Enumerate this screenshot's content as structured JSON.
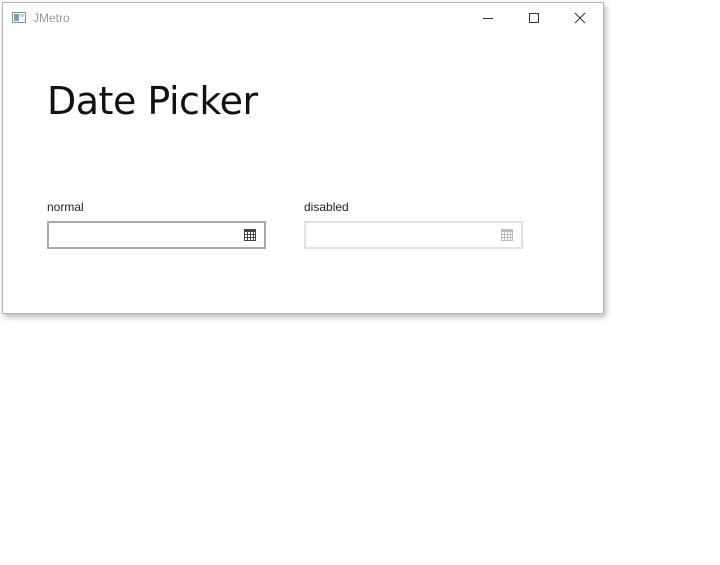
{
  "window": {
    "title": "JMetro",
    "controls": [
      "minimize-icon",
      "maximize-icon",
      "close-icon"
    ]
  },
  "main": {
    "title": "Date Picker",
    "pickers": [
      {
        "label": "normal",
        "value": "",
        "enabled": true,
        "icon": "calendar-icon"
      },
      {
        "label": "disabled",
        "value": "",
        "enabled": false,
        "icon": "calendar-icon"
      }
    ]
  },
  "colors": {
    "border_normal": "#a9a9a9",
    "border_disabled": "#e2e2e2",
    "icon_normal": "#444444",
    "icon_disabled": "#bdbdbd",
    "title_text": "#111111"
  }
}
